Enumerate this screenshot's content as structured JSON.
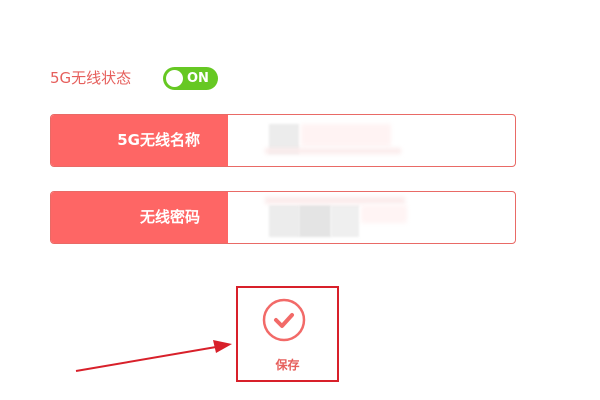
{
  "status": {
    "label": "5G无线状态",
    "toggle_text": "ON",
    "toggle_color": "#66c823"
  },
  "fields": {
    "ssid": {
      "label": "5G无线名称",
      "value": ""
    },
    "password": {
      "label": "无线密码",
      "value": ""
    }
  },
  "save": {
    "label": "保存",
    "icon": "check-circle-icon"
  },
  "colors": {
    "accent": "#fe6665",
    "text_accent": "#e65f5c",
    "highlight_red": "#d8202a"
  }
}
